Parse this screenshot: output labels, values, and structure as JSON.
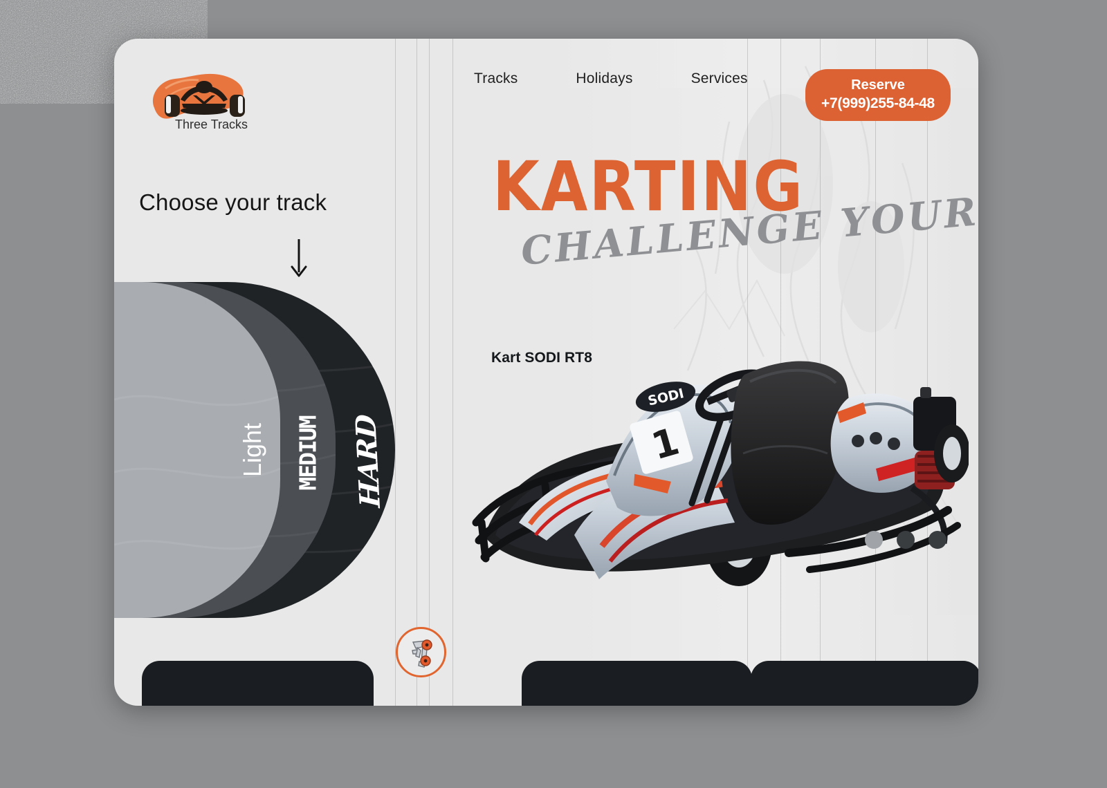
{
  "page": {
    "background_color": "#8d8f91",
    "card_color": "#e8e8e8",
    "accent_color": "#dc6234",
    "dark_color": "#1a1d21"
  },
  "header": {
    "logo": {
      "icon": "kart-logo-icon",
      "text": "Three Tracks"
    },
    "nav": [
      {
        "label": "Tracks"
      },
      {
        "label": "Holidays"
      },
      {
        "label": "Services"
      }
    ],
    "reserve": {
      "label": "Reserve",
      "phone": "+7(999)255-84-48",
      "color": "#dc6234"
    }
  },
  "hero": {
    "title": "KARTING",
    "title_color": "#dd6432",
    "subtitle": "CHALLENGE YOURSELF",
    "subtitle_color": "#8e9093"
  },
  "track_selector": {
    "heading": "Choose your track",
    "arrow_icon": "arrow-down-icon",
    "panels": [
      {
        "label": "Light",
        "color": "#a9adb1"
      },
      {
        "label": "MEDIUM",
        "color": "#4b4f54"
      },
      {
        "label": "HARD",
        "color": "#202326"
      }
    ]
  },
  "product": {
    "caption": "Kart SODI RT8",
    "image_alt": "racing-go-kart-photo"
  },
  "carousel": {
    "dots": [
      {
        "state": "active",
        "color": "#a0a4a8"
      },
      {
        "state": "inactive",
        "color": "#3a3d40"
      },
      {
        "state": "inactive",
        "color": "#3a3d40"
      }
    ]
  },
  "divider_badge": {
    "icon": "kart-chassis-icon",
    "border_color": "#e0652f"
  },
  "bottom_cards": [
    {
      "color": "#1a1d21"
    },
    {
      "color": "#1a1d21"
    },
    {
      "color": "#1a1d21"
    }
  ]
}
